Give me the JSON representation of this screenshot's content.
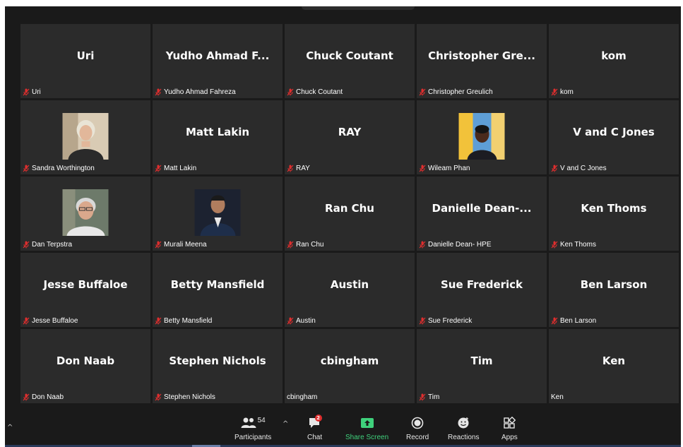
{
  "tiles": [
    {
      "name": "Uri",
      "label": "Uri",
      "muted": true,
      "video": false
    },
    {
      "name": "Yudho Ahmad F...",
      "label": "Yudho Ahmad Fahreza",
      "muted": true,
      "video": false
    },
    {
      "name": "Chuck Coutant",
      "label": "Chuck Coutant",
      "muted": true,
      "video": false
    },
    {
      "name": "Christopher Gre...",
      "label": "Christopher Greulich",
      "muted": true,
      "video": false
    },
    {
      "name": "kom",
      "label": "kom",
      "muted": true,
      "video": false
    },
    {
      "name": "",
      "label": "Sandra Worthington",
      "muted": true,
      "video": true,
      "photo": "older-woman-light-background"
    },
    {
      "name": "Matt Lakin",
      "label": "Matt Lakin",
      "muted": true,
      "video": false
    },
    {
      "name": "RAY",
      "label": "RAY",
      "muted": true,
      "video": false
    },
    {
      "name": "",
      "label": "Wileam Phan",
      "muted": true,
      "video": true,
      "photo": "woman-blue-yellow-background"
    },
    {
      "name": "V and C Jones",
      "label": "V and C Jones",
      "muted": true,
      "video": false
    },
    {
      "name": "",
      "label": "Dan Terpstra",
      "muted": true,
      "video": true,
      "photo": "older-man-glasses"
    },
    {
      "name": "",
      "label": "Murali Meena",
      "muted": true,
      "video": true,
      "photo": "man-dark-suit-portrait"
    },
    {
      "name": "Ran Chu",
      "label": "Ran Chu",
      "muted": true,
      "video": false
    },
    {
      "name": "Danielle  Dean-...",
      "label": "Danielle Dean- HPE",
      "muted": true,
      "video": false
    },
    {
      "name": "Ken Thoms",
      "label": "Ken Thoms",
      "muted": true,
      "video": false
    },
    {
      "name": "Jesse Buffaloe",
      "label": "Jesse Buffaloe",
      "muted": true,
      "video": false
    },
    {
      "name": "Betty Mansfield",
      "label": "Betty Mansfield",
      "muted": true,
      "video": false
    },
    {
      "name": "Austin",
      "label": "Austin",
      "muted": true,
      "video": false
    },
    {
      "name": "Sue Frederick",
      "label": "Sue Frederick",
      "muted": true,
      "video": false
    },
    {
      "name": "Ben Larson",
      "label": "Ben Larson",
      "muted": true,
      "video": false
    },
    {
      "name": "Don Naab",
      "label": "Don Naab",
      "muted": true,
      "video": false
    },
    {
      "name": "Stephen Nichols",
      "label": "Stephen Nichols",
      "muted": true,
      "video": false
    },
    {
      "name": "cbingham",
      "label": "cbingham",
      "muted": false,
      "video": false
    },
    {
      "name": "Tim",
      "label": "Tim",
      "muted": true,
      "video": false
    },
    {
      "name": "Ken",
      "label": "Ken",
      "muted": false,
      "video": false
    }
  ],
  "toolbar": {
    "participants": {
      "label": "Participants",
      "count": "54",
      "icon": "participants-icon"
    },
    "chat": {
      "label": "Chat",
      "badge": "2",
      "icon": "chat-icon"
    },
    "share": {
      "label": "Share Screen",
      "icon": "share-screen-icon"
    },
    "record": {
      "label": "Record",
      "icon": "record-icon"
    },
    "reactions": {
      "label": "Reactions",
      "icon": "reactions-icon"
    },
    "apps": {
      "label": "Apps",
      "icon": "apps-icon"
    }
  },
  "colors": {
    "background": "#1a1a1a",
    "tile": "#2b2b2b",
    "mute": "#e02e2e",
    "share": "#3fd17c"
  }
}
